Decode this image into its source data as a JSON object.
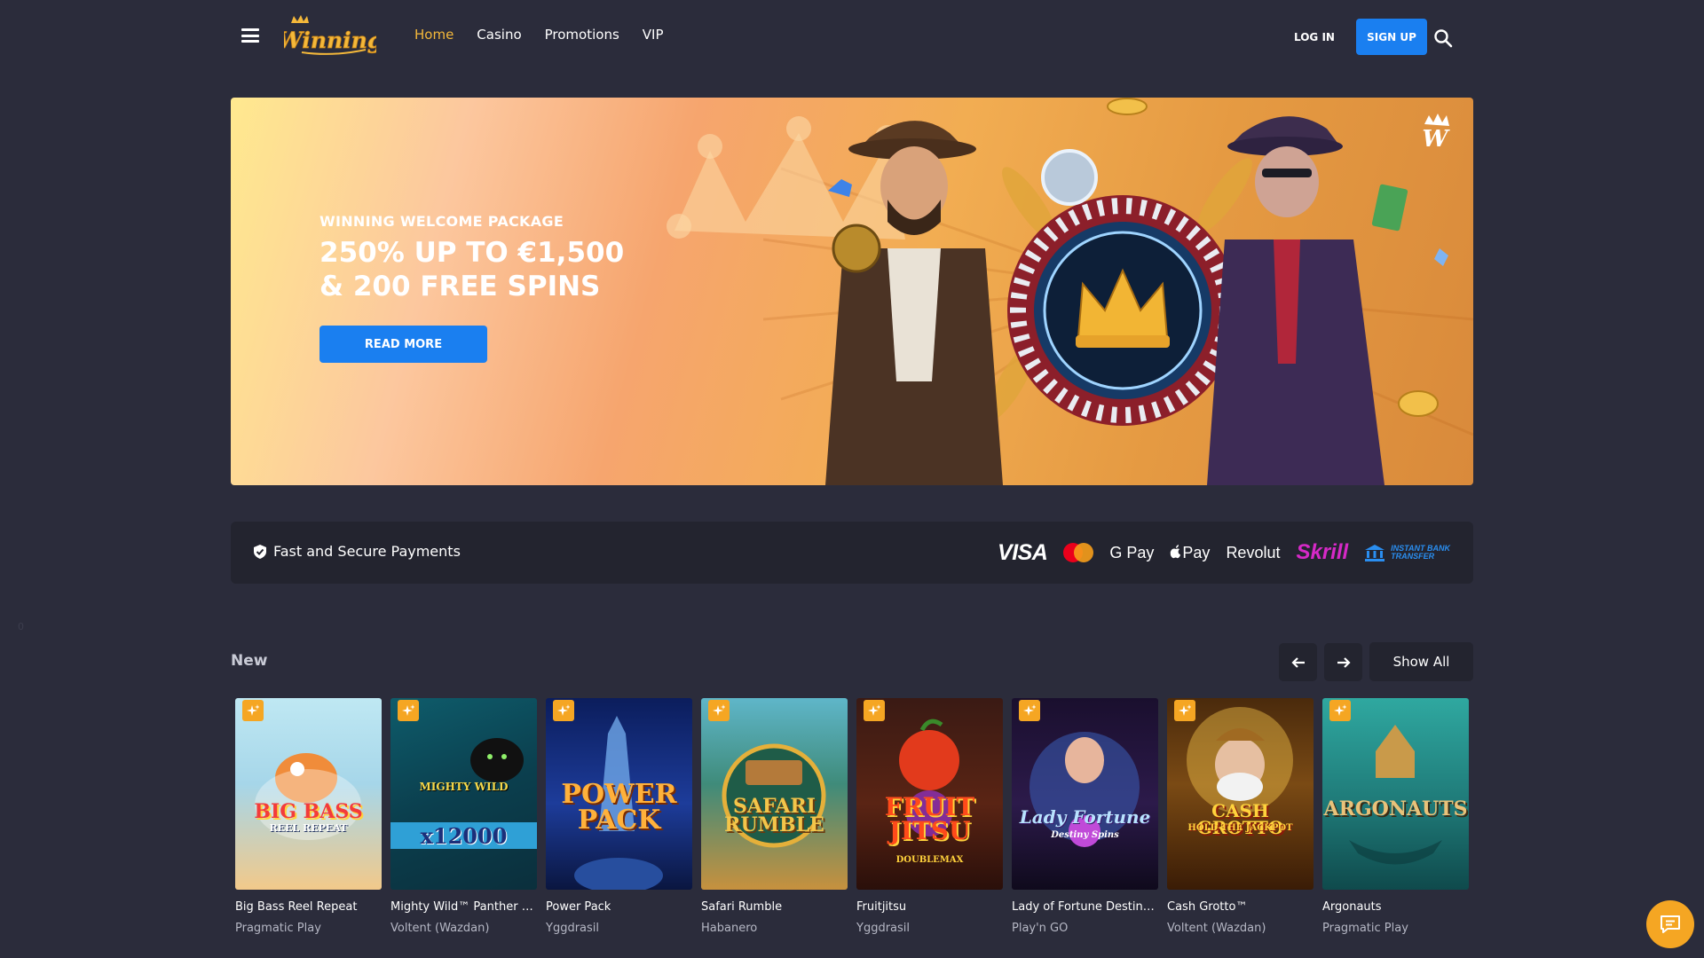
{
  "header": {
    "logo_text": "Winning",
    "nav": [
      "Home",
      "Casino",
      "Promotions",
      "VIP"
    ],
    "login": "LOG IN",
    "signup": "SIGN UP"
  },
  "hero": {
    "kicker": "WINNING WELCOME PACKAGE",
    "title_line1": "250% UP TO €1,500",
    "title_line2": "& 200 FREE SPINS",
    "cta": "READ MORE"
  },
  "payments": {
    "label": "Fast and Secure Payments",
    "methods": {
      "visa": "VISA",
      "gpay": "G Pay",
      "applepay": "Pay",
      "revolut": "Revolut",
      "skrill": "Skrill",
      "bank_line1": "INSTANT BANK",
      "bank_line2": "TRANSFER"
    }
  },
  "stray_text": "0",
  "new_section": {
    "title": "New",
    "show_all": "Show All"
  },
  "games": [
    {
      "name": "Big Bass Reel Repeat",
      "provider": "Pragmatic Play",
      "art": "BIG BASS",
      "art_sub": "REEL REPEAT"
    },
    {
      "name": "Mighty Wild™ Panther Di...",
      "provider": "Voltent (Wazdan)",
      "art": "MIGHTY WILD",
      "art_sub": "x12000"
    },
    {
      "name": "Power Pack",
      "provider": "Yggdrasil",
      "art": "POWER PACK",
      "art_sub": ""
    },
    {
      "name": "Safari Rumble",
      "provider": "Habanero",
      "art": "SAFARI RUMBLE",
      "art_sub": ""
    },
    {
      "name": "Fruitjitsu",
      "provider": "Yggdrasil",
      "art": "FRUIT JITSU",
      "art_sub": "DOUBLEMAX"
    },
    {
      "name": "Lady of Fortune Destiny S...",
      "provider": "Play'n GO",
      "art": "Lady Fortune",
      "art_sub": "Destiny Spins"
    },
    {
      "name": "Cash Grotto™",
      "provider": "Voltent (Wazdan)",
      "art": "CASH GROTTO",
      "art_sub": "HOLD THE JACKPOT"
    },
    {
      "name": "Argonauts",
      "provider": "Pragmatic Play",
      "art": "ARGONAUTS",
      "art_sub": ""
    }
  ],
  "colors": {
    "background": "#2b2c3b",
    "panel": "#23242f",
    "accent_blue": "#1a7ff0",
    "accent_gold": "#f4b83a"
  }
}
